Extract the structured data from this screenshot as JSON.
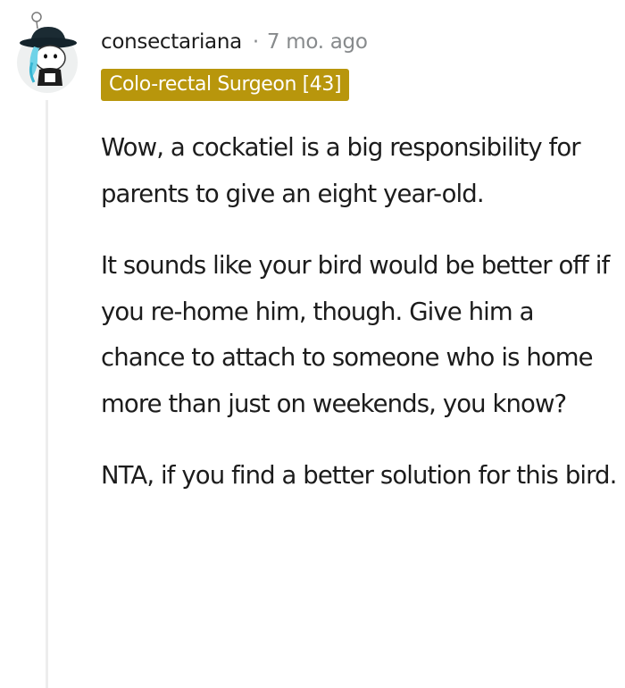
{
  "comment": {
    "author": "consectariana",
    "separator": "·",
    "time_ago": "7 mo. ago",
    "flair": "Colo-rectal Surgeon [43]",
    "flair_color": "#b8960c",
    "paragraphs": [
      "Wow, a cockatiel is a big responsibility for parents to give an eight year-old.",
      "It sounds like your bird would be better off if you re-home him, though. Give him a chance to attach to someone who is home more than just on weekends, you know?",
      "NTA, if you find a better solution for this bird."
    ]
  }
}
